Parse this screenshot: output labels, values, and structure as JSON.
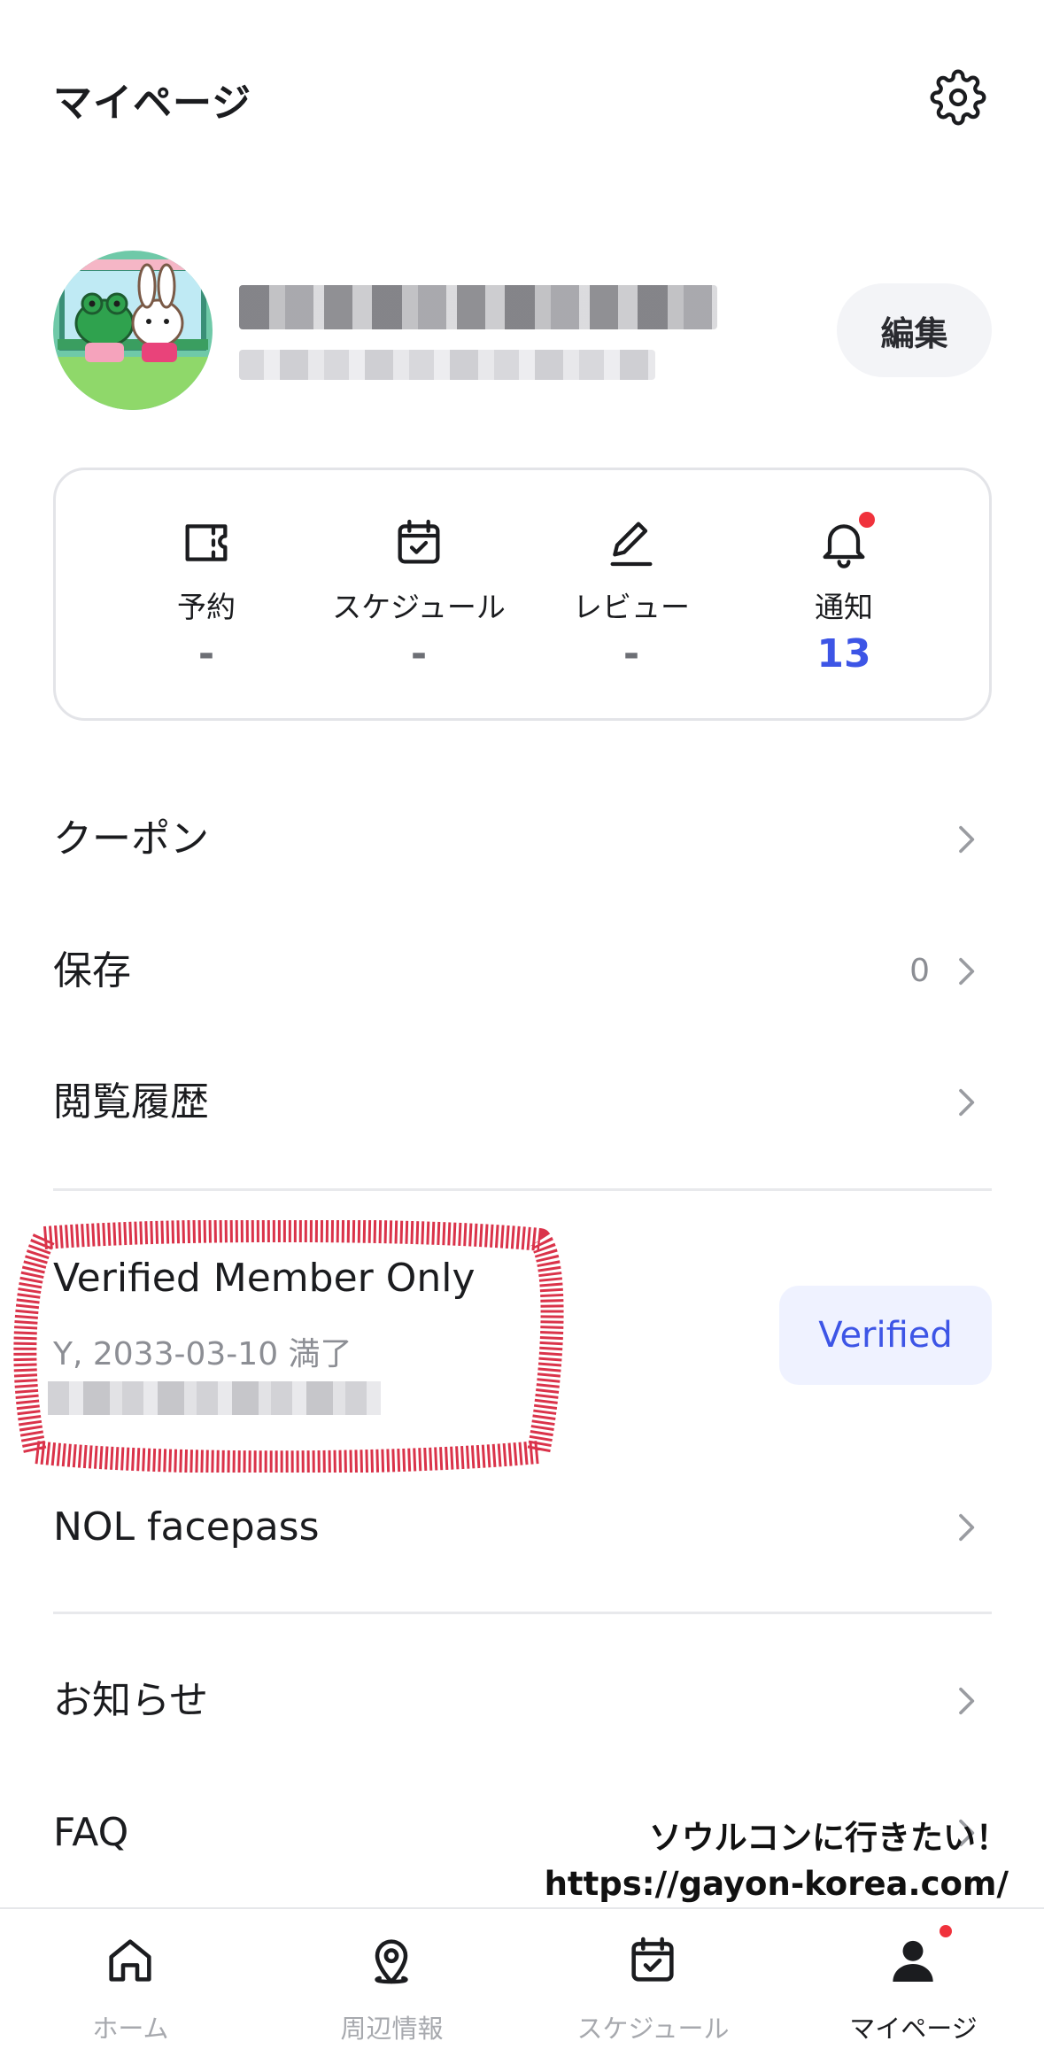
{
  "header": {
    "title": "マイページ",
    "settings_icon": "gear-icon"
  },
  "profile": {
    "edit_label": "編集"
  },
  "stats": [
    {
      "icon": "ticket-icon",
      "label": "予約",
      "value": "-"
    },
    {
      "icon": "calendar-check-icon",
      "label": "スケジュール",
      "value": "-"
    },
    {
      "icon": "pencil-icon",
      "label": "レビュー",
      "value": "-"
    },
    {
      "icon": "bell-icon",
      "label": "通知",
      "value": "13"
    }
  ],
  "menu": {
    "coupon": "クーポン",
    "saved": "保存",
    "saved_count": "0",
    "history": "閲覧履歴",
    "facepass": "NOL facepass",
    "notice": "お知らせ",
    "faq": "FAQ"
  },
  "verified": {
    "title": "Verified Member Only",
    "subtitle": "Y, 2033-03-10 満了",
    "button": "Verified"
  },
  "watermark": {
    "line1": "ソウルコンに行きたい！",
    "line2": "https://gayon-korea.com/"
  },
  "tabbar": [
    {
      "icon": "home-icon",
      "label": "ホーム",
      "active": false
    },
    {
      "icon": "map-pin-icon",
      "label": "周辺情報",
      "active": false
    },
    {
      "icon": "calendar-check-icon",
      "label": "スケジュール",
      "active": false
    },
    {
      "icon": "user-icon",
      "label": "マイページ",
      "active": true
    }
  ],
  "colors": {
    "accent": "#3d55e6",
    "badge": "#f0323c",
    "annotation": "#d40f2a"
  }
}
